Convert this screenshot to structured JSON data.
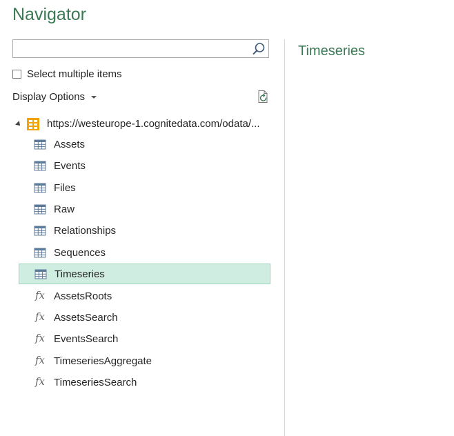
{
  "window": {
    "title": "Navigator"
  },
  "search": {
    "value": "",
    "placeholder": ""
  },
  "select_multiple": {
    "label": "Select multiple items",
    "checked": false
  },
  "display_options": {
    "label": "Display Options"
  },
  "tree": {
    "root": {
      "label": "https://westeurope-1.cognitedata.com/odata/...",
      "expanded": true,
      "icon": "database-icon"
    },
    "items": [
      {
        "label": "Assets",
        "type": "table",
        "selected": false
      },
      {
        "label": "Events",
        "type": "table",
        "selected": false
      },
      {
        "label": "Files",
        "type": "table",
        "selected": false
      },
      {
        "label": "Raw",
        "type": "table",
        "selected": false
      },
      {
        "label": "Relationships",
        "type": "table",
        "selected": false
      },
      {
        "label": "Sequences",
        "type": "table",
        "selected": false
      },
      {
        "label": "Timeseries",
        "type": "table",
        "selected": true
      },
      {
        "label": "AssetsRoots",
        "type": "function",
        "selected": false
      },
      {
        "label": "AssetsSearch",
        "type": "function",
        "selected": false
      },
      {
        "label": "EventsSearch",
        "type": "function",
        "selected": false
      },
      {
        "label": "TimeseriesAggregate",
        "type": "function",
        "selected": false
      },
      {
        "label": "TimeseriesSearch",
        "type": "function",
        "selected": false
      }
    ]
  },
  "preview": {
    "title": "Timeseries"
  },
  "colors": {
    "accent": "#3c7a55",
    "selection": "#cfede0",
    "selection_border": "#9fd6bb",
    "db_icon": "#f0a30a"
  }
}
